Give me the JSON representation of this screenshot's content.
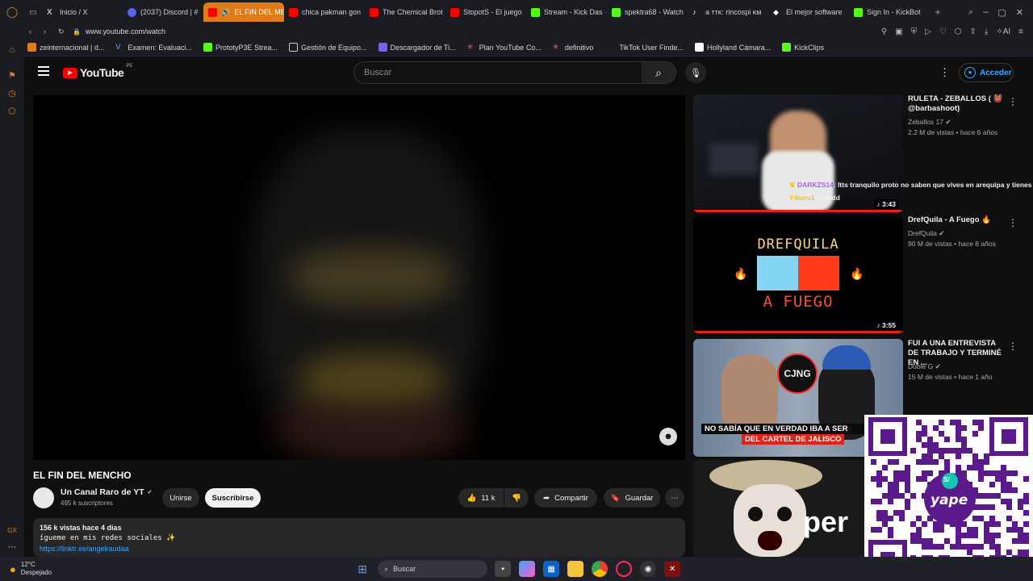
{
  "browser": {
    "tabs": [
      {
        "label": "Inicio / X",
        "color": "#ffffff"
      },
      {
        "label": "(2037) Discord | #",
        "color": "#5865f2"
      },
      {
        "label": "EL FIN DEL MENCH",
        "color": "#ff0000",
        "active": true
      },
      {
        "label": "chica pakman gon",
        "color": "#ff0000"
      },
      {
        "label": "The Chemical Brot",
        "color": "#ff0000"
      },
      {
        "label": "StopotS - El juego",
        "color": "#ff0000"
      },
      {
        "label": "Stream - Kick Das",
        "color": "#53fc18"
      },
      {
        "label": "spektra68 - Watch",
        "color": "#53fc18"
      },
      {
        "label": "a ᴛᴛᴋ: rincospi ᴋᴍ",
        "color": "#ffffff"
      },
      {
        "label": "El mejor software",
        "color": "#ffffff"
      },
      {
        "label": "Sign In - KickBot",
        "color": "#53fc18"
      }
    ],
    "url": "www.youtube.com/watch",
    "bookmarks": [
      "zeinternacional | d...",
      "Examen: Evaluaci...",
      "PrototyP3E Strea...",
      "Gestión de Equipo...",
      "Descargador de Ti...",
      "Plan YouTube Co...",
      "definitivo",
      "TikTok User Finde...",
      "Hollyland Cámara...",
      "KickClips"
    ]
  },
  "youtube": {
    "logo": "YouTube",
    "region": "PE",
    "search_placeholder": "Buscar",
    "signin": "Acceder",
    "video": {
      "title": "EL FIN DEL MENCHO",
      "channel": "Un Canal Raro de YT",
      "subscribers": "495 k suscriptores",
      "join": "Unirse",
      "subscribe": "Suscribirse",
      "likes": "11 k",
      "share": "Compartir",
      "save": "Guardar",
      "views_date": "156 k vistas  hace 4 días",
      "description": "ígueme en mis redes sociales ✨",
      "link": "https://linktr.ee/angelraudaa"
    },
    "recommendations": [
      {
        "title": "RULETA - ZEBALLOS ( 👹 @barbashoot)",
        "channel": "Zeballos 17",
        "meta": "2.2 M de vistas • hace 6 años",
        "duration": "3:43"
      },
      {
        "title": "DrefQuila - A Fuego 🔥",
        "channel": "DrefQuila",
        "meta": "90 M de vistas • hace 8 años",
        "duration": "3:55",
        "thumb_text1": "DREFQUILA",
        "thumb_text2": "A FUEGO"
      },
      {
        "title": "FUI A UNA ENTREVISTA DE TRABAJO Y TERMINÉ EN ...",
        "channel": "Doble G",
        "meta": "15 M de vistas • hace 1 año",
        "thumb_badge": "CJNG",
        "thumb_caption1": "NO SABÍA QUE EN VERDAD IBA A SER",
        "thumb_caption2": "DEL CARTEL DE JALISCO"
      },
      {
        "thumb_text": "per"
      }
    ],
    "chat_overlay": {
      "line1_user": "DARKZS14",
      "line1_text": ": ltts tranquilo proto no saben que vives en arequipa y tienes 2",
      "line2_user": "Y4toro1",
      "line2_text": ": Xdxdd"
    }
  },
  "qr": {
    "brand": "yape",
    "symbol": "S/"
  },
  "taskbar": {
    "temp": "12°C",
    "weather": "Despejado",
    "search": "Buscar"
  }
}
